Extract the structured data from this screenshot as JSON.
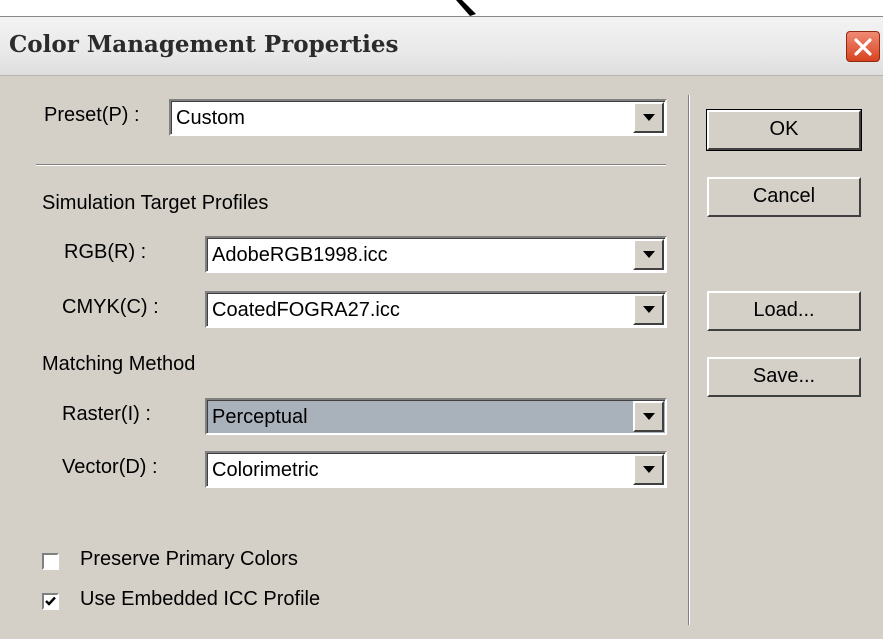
{
  "dialog": {
    "title": "Color Management Properties"
  },
  "preset": {
    "label": "Preset(P) :",
    "value": "Custom"
  },
  "simulation": {
    "heading": "Simulation Target Profiles",
    "rgb": {
      "label": "RGB(R) :",
      "value": "AdobeRGB1998.icc"
    },
    "cmyk": {
      "label": "CMYK(C) :",
      "value": "CoatedFOGRA27.icc"
    }
  },
  "matching": {
    "heading": "Matching Method",
    "raster": {
      "label": "Raster(I) :",
      "value": "Perceptual"
    },
    "vector": {
      "label": "Vector(D) :",
      "value": "Colorimetric"
    }
  },
  "options": {
    "preserve_primary": {
      "label": "Preserve Primary Colors",
      "checked": false
    },
    "use_embedded_icc": {
      "label": "Use Embedded ICC Profile",
      "checked": true
    }
  },
  "buttons": {
    "ok": "OK",
    "cancel": "Cancel",
    "load": "Load...",
    "save": "Save..."
  },
  "colors": {
    "dialog_bg": "#d4d0c8",
    "close_button": "#d8431f",
    "selected_field": "#a9b1bb"
  },
  "icons": {
    "close": "close-x-icon",
    "dropdown": "down-arrow-icon",
    "check": "check-mark-icon",
    "cursor": "mouse-cursor-icon"
  }
}
